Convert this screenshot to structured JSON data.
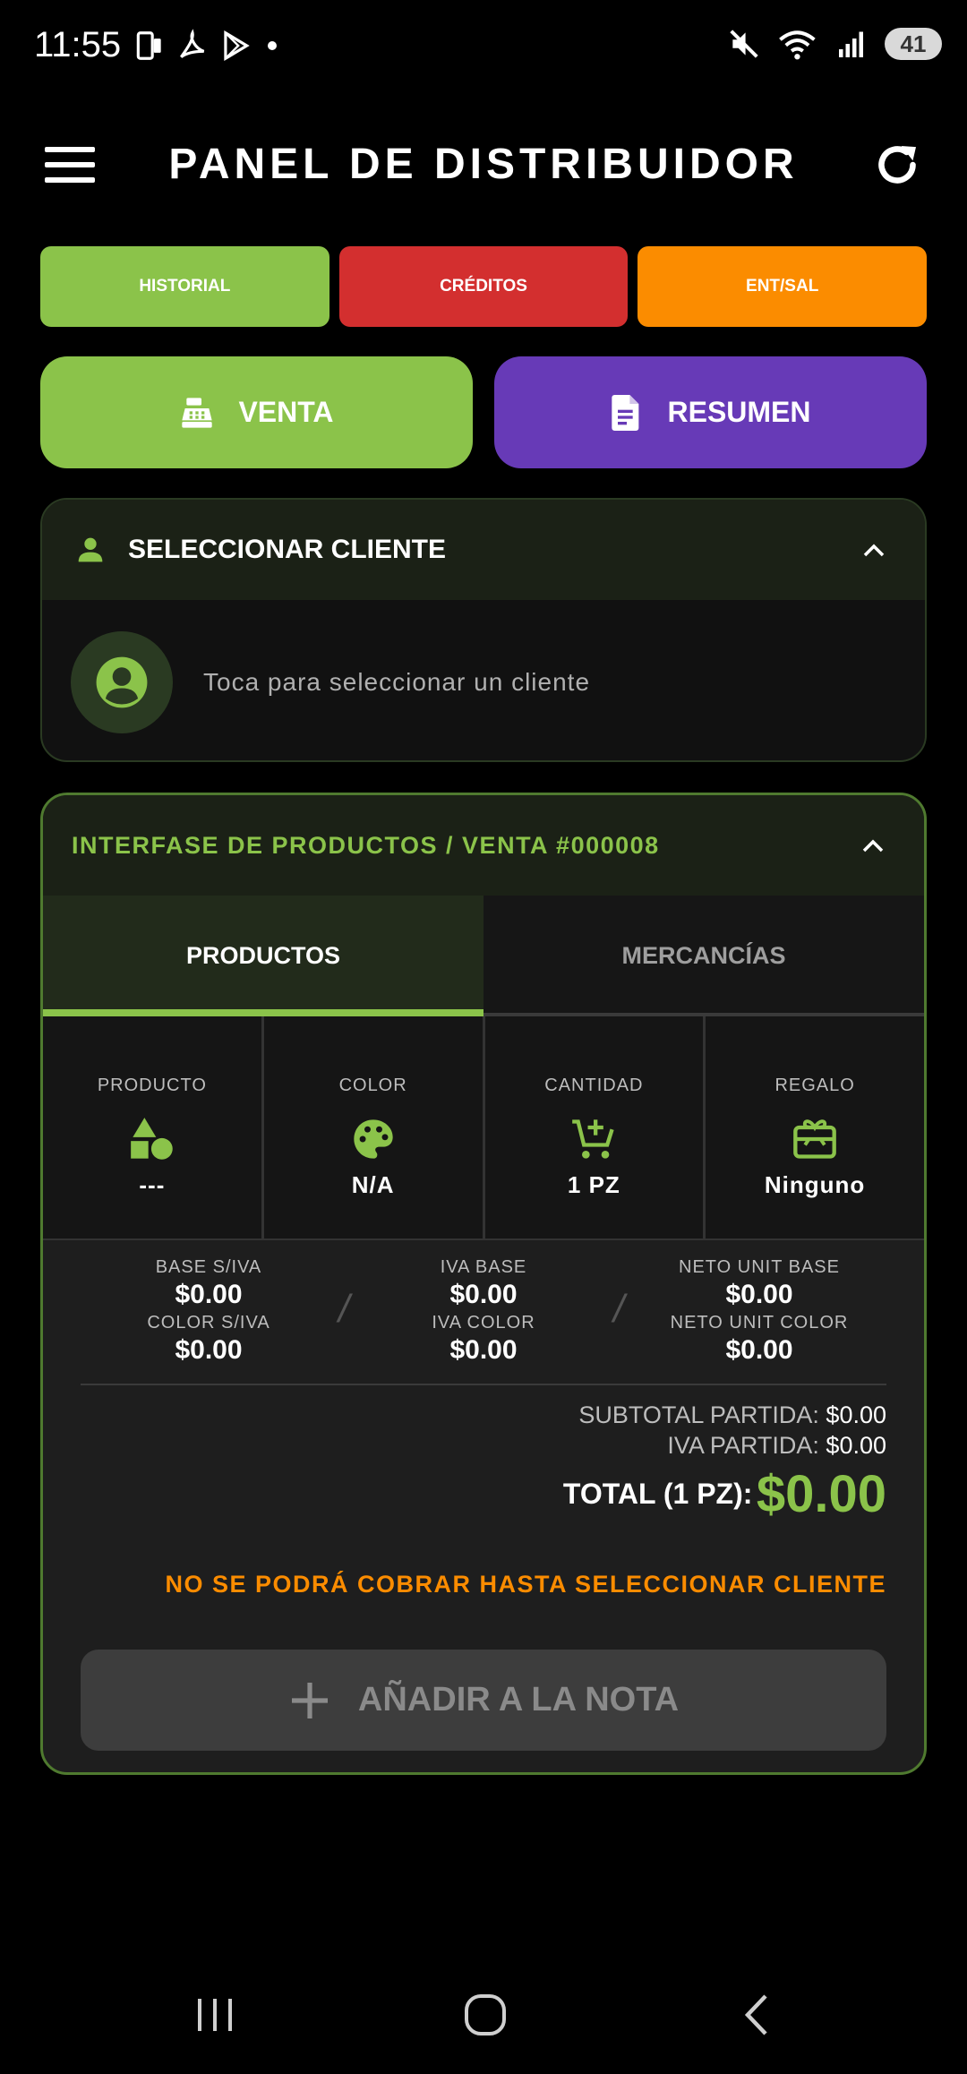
{
  "status_bar": {
    "time": "11:55",
    "battery": "41"
  },
  "header": {
    "title": "PANEL DE DISTRIBUIDOR"
  },
  "top_buttons": {
    "historial": "HISTORIAL",
    "creditos": "CRÉDITOS",
    "ent_sal": "ENT/SAL"
  },
  "action_buttons": {
    "venta": "VENTA",
    "resumen": "RESUMEN"
  },
  "client": {
    "header": "SELECCIONAR CLIENTE",
    "hint": "Toca para seleccionar un cliente"
  },
  "products": {
    "title": "INTERFASE DE PRODUCTOS / VENTA #000008",
    "tabs": [
      "PRODUCTOS",
      "MERCANCÍAS"
    ],
    "selectors": [
      {
        "label": "PRODUCTO",
        "value": "---"
      },
      {
        "label": "COLOR",
        "value": "N/A"
      },
      {
        "label": "CANTIDAD",
        "value": "1 PZ"
      },
      {
        "label": "REGALO",
        "value": "Ninguno"
      }
    ],
    "prices": {
      "base_siva_label": "BASE S/IVA",
      "base_siva": "$0.00",
      "color_siva_label": "COLOR S/IVA",
      "color_siva": "$0.00",
      "iva_base_label": "IVA BASE",
      "iva_base": "$0.00",
      "iva_color_label": "IVA COLOR",
      "iva_color": "$0.00",
      "neto_unit_base_label": "NETO UNIT BASE",
      "neto_unit_base": "$0.00",
      "neto_unit_color_label": "NETO UNIT COLOR",
      "neto_unit_color": "$0.00"
    },
    "totals": {
      "subtotal_label": "SUBTOTAL PARTIDA:",
      "subtotal": "$0.00",
      "iva_label": "IVA PARTIDA:",
      "iva": "$0.00",
      "total_label": "TOTAL (1 PZ):",
      "total": "$0.00"
    },
    "warning": "NO SE PODRÁ COBRAR HASTA SELECCIONAR CLIENTE",
    "add_button": "AÑADIR A LA NOTA"
  },
  "colors": {
    "green": "#8bc34a",
    "red": "#d32f2f",
    "orange": "#fb8c00",
    "purple": "#673ab7"
  }
}
